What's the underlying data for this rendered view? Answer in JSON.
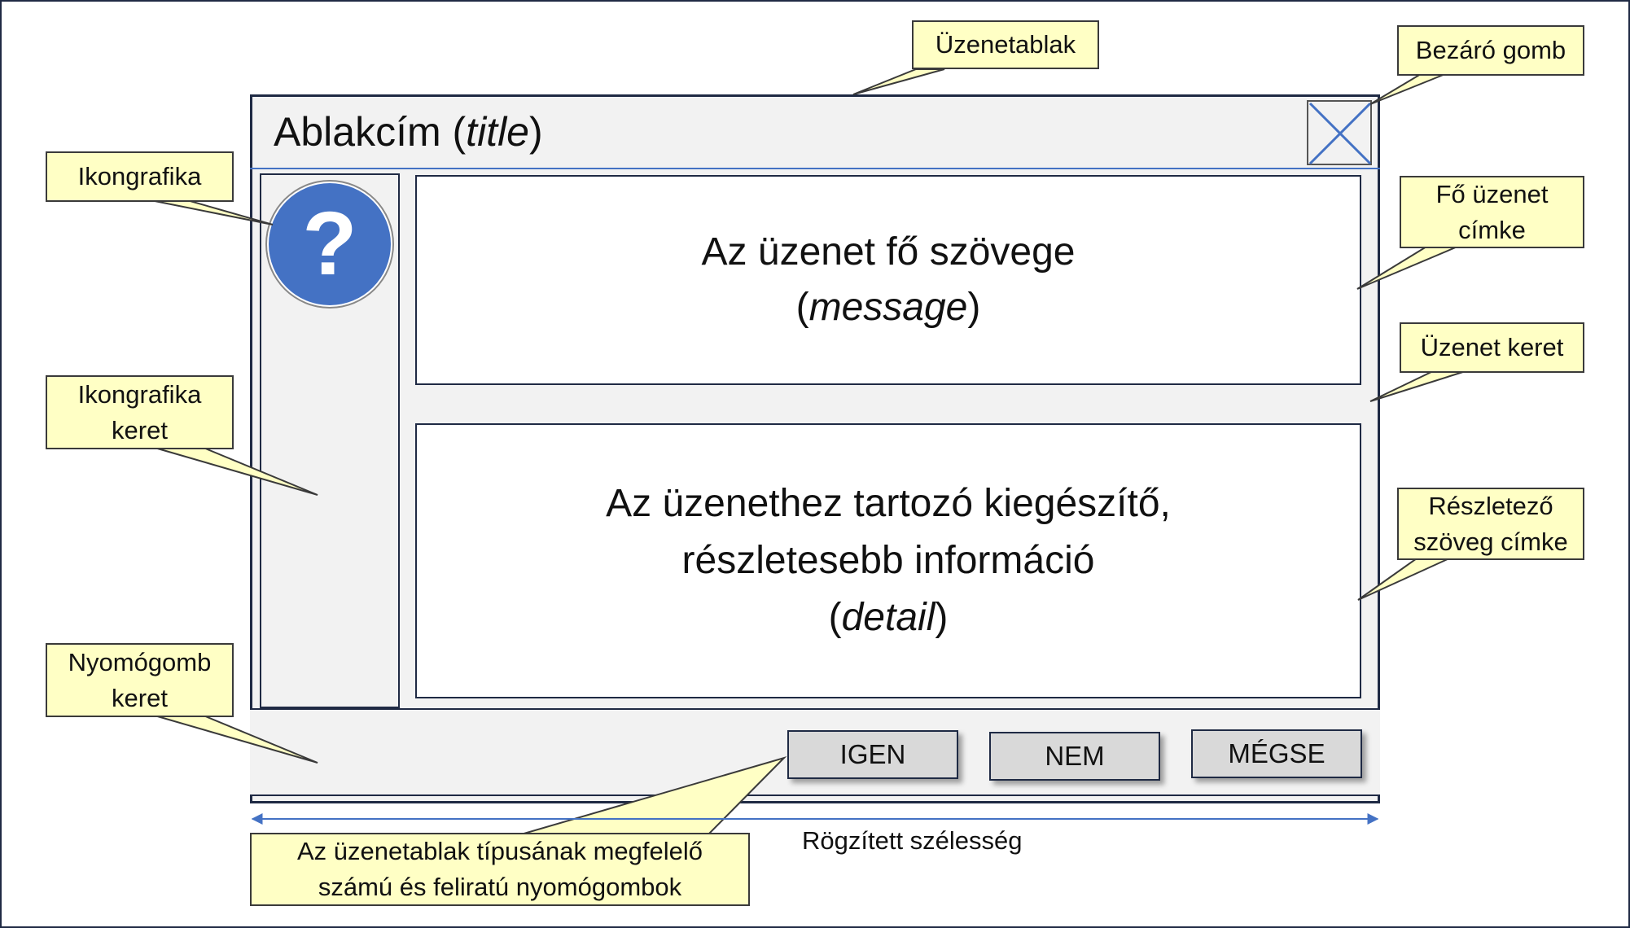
{
  "window": {
    "title_main": "Ablakcím (",
    "title_italic": "title",
    "title_end": ")"
  },
  "icon": {
    "glyph": "?",
    "name": "question-icon",
    "color": "#4472c4"
  },
  "message": {
    "line1": "Az üzenet fő szövege",
    "open": "(",
    "italic": "message",
    "close": ")"
  },
  "detail": {
    "line1": "Az üzenethez tartozó kiegészítő,",
    "line2": "részletesebb információ",
    "open": "(",
    "italic": "detail",
    "close": ")"
  },
  "buttons": [
    {
      "label": "IGEN"
    },
    {
      "label": "NEM"
    },
    {
      "label": "MÉGSE"
    }
  ],
  "callouts": {
    "uzenetablak": "Üzenetablak",
    "bezaro": "Bezáró gomb",
    "ikongrafika": "Ikongrafika",
    "fo_uzenet_1": "Fő üzenet",
    "fo_uzenet_2": "címke",
    "uzenet_keret": "Üzenet keret",
    "ikon_keret_1": "Ikongrafika",
    "ikon_keret_2": "keret",
    "reszletezo_1": "Részletező",
    "reszletezo_2": "szöveg címke",
    "nyomogomb_1": "Nyomógomb",
    "nyomogomb_2": "keret",
    "gombok_1": "Az üzenetablak típusának megfelelő",
    "gombok_2": "számú és feliratú nyomógombok"
  },
  "width_label": "Rögzített szélesség",
  "colors": {
    "callout_fill": "#ffffc5",
    "accent": "#4472c4",
    "panel": "#f2f2f2",
    "button": "#d9d9d9"
  }
}
